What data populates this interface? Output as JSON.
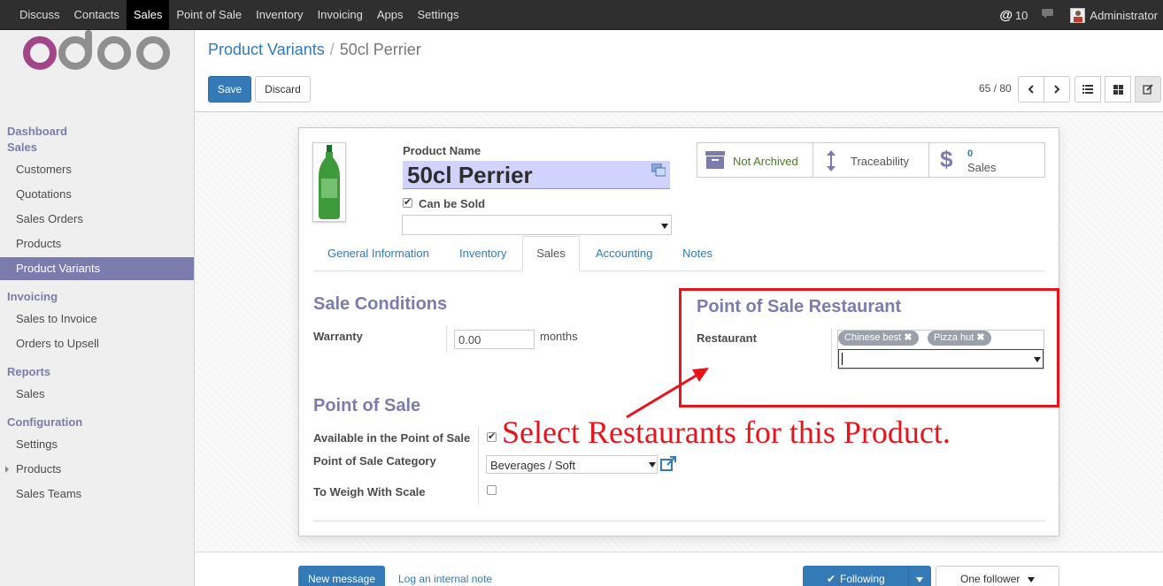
{
  "topbar": {
    "menu": [
      "Discuss",
      "Contacts",
      "Sales",
      "Point of Sale",
      "Inventory",
      "Invoicing",
      "Apps",
      "Settings"
    ],
    "active": "Sales",
    "notification_count": "10",
    "user": "Administrator"
  },
  "sidebar": {
    "logo": "odoo",
    "dashboard": "Dashboard",
    "sales_head": "Sales",
    "sales_items": [
      "Customers",
      "Quotations",
      "Sales Orders",
      "Products",
      "Product Variants"
    ],
    "invoicing_head": "Invoicing",
    "invoicing_items": [
      "Sales to Invoice",
      "Orders to Upsell"
    ],
    "reports_head": "Reports",
    "reports_items": [
      "Sales"
    ],
    "config_head": "Configuration",
    "config_items": [
      "Settings",
      "Products",
      "Sales Teams"
    ]
  },
  "control": {
    "breadcrumb_parent": "Product Variants",
    "breadcrumb_current": "50cl Perrier",
    "save_label": "Save",
    "discard_label": "Discard",
    "pager": "65 / 80"
  },
  "form": {
    "product_name_label": "Product Name",
    "product_name": "50cl Perrier",
    "can_be_sold_label": "Can be Sold",
    "smart_buttons": {
      "archived": "Not Archived",
      "traceability": "Traceability",
      "sales_count": "0",
      "sales_label": "Sales"
    },
    "tabs": [
      "General Information",
      "Inventory",
      "Sales",
      "Accounting",
      "Notes"
    ],
    "active_tab": "Sales",
    "sale_conditions_title": "Sale Conditions",
    "warranty_label": "Warranty",
    "warranty_value": "0.00",
    "warranty_unit": "months",
    "pos_restaurant_title": "Point of Sale Restaurant",
    "restaurant_label": "Restaurant",
    "restaurant_tags": [
      "Chinese best",
      "Pizza hut"
    ],
    "pos_title": "Point of Sale",
    "available_label": "Available in the Point of Sale",
    "category_label": "Point of Sale Category",
    "category_value": "Beverages / Soft",
    "weigh_label": "To Weigh With Scale"
  },
  "annotation": "Select Restaurants for this Product.",
  "chatter": {
    "new_message": "New message",
    "log_note": "Log an internal note",
    "following": "Following",
    "followers": "One follower"
  },
  "colors": {
    "topbar": "#2f2f2f",
    "accent": "#7c7bad",
    "primary": "#337ab7",
    "annotation": "#e8141c"
  }
}
